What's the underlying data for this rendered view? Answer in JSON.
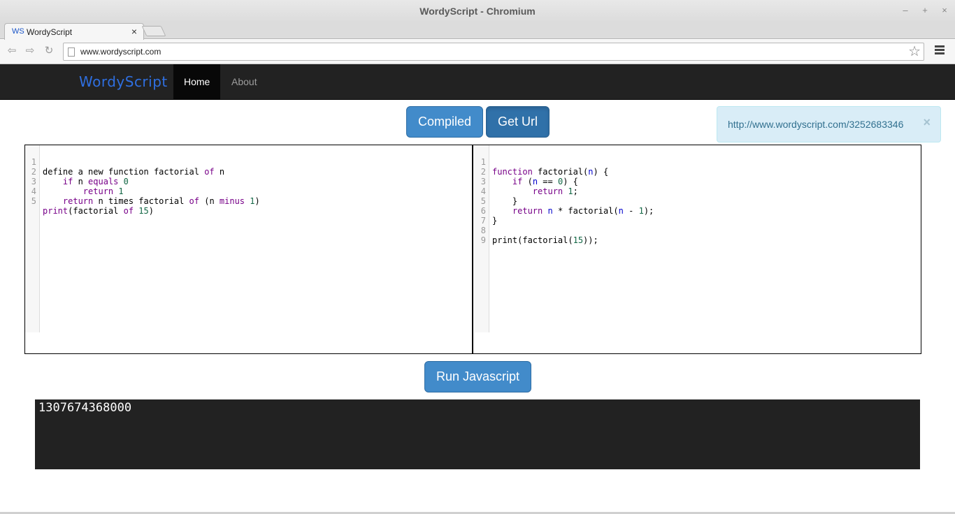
{
  "window": {
    "title": "WordyScript - Chromium",
    "minimize_glyph": "–",
    "maximize_glyph": "+",
    "close_glyph": "×"
  },
  "tab": {
    "favicon_text": "WS",
    "title": "WordyScript",
    "close_glyph": "×"
  },
  "toolbar": {
    "back_glyph": "⇦",
    "forward_glyph": "⇨",
    "reload_glyph": "↻",
    "url": "www.wordyscript.com",
    "star_glyph": "☆"
  },
  "site_nav": {
    "brand": "WordyScript",
    "links": [
      "Home",
      "About"
    ],
    "active": "Home"
  },
  "actions": {
    "compiled_label": "Compiled",
    "get_url_label": "Get Url",
    "run_label": "Run Javascript"
  },
  "alert": {
    "link_text": "http://www.wordyscript.com/3252683346",
    "close_glyph": "×"
  },
  "editor_wordy": {
    "line_numbers": [
      "1",
      "2",
      "3",
      "4",
      "5"
    ],
    "lines": [
      "define a new function factorial of n",
      "    if n equals 0",
      "        return 1",
      "    return n times factorial of (n minus 1)",
      "print(factorial of 15)"
    ]
  },
  "editor_js": {
    "line_numbers": [
      "1",
      "2",
      "3",
      "4",
      "5",
      "6",
      "7",
      "8",
      "9"
    ],
    "lines": [
      "function factorial(n) {",
      "    if (n == 0) {",
      "        return 1;",
      "    }",
      "    return n * factorial(n - 1);",
      "}",
      "",
      "print(factorial(15));",
      ""
    ]
  },
  "output": {
    "text": "1307674368000"
  },
  "colors": {
    "primary": "#428bca",
    "primary_active": "#3071a9",
    "navbar_bg": "#222222",
    "brand": "#2f6fe0",
    "alert_bg": "#d9edf7",
    "alert_text": "#31708f",
    "keyword": "#770088",
    "number": "#116644",
    "variable": "#0000cc",
    "console_bg": "#222222"
  }
}
